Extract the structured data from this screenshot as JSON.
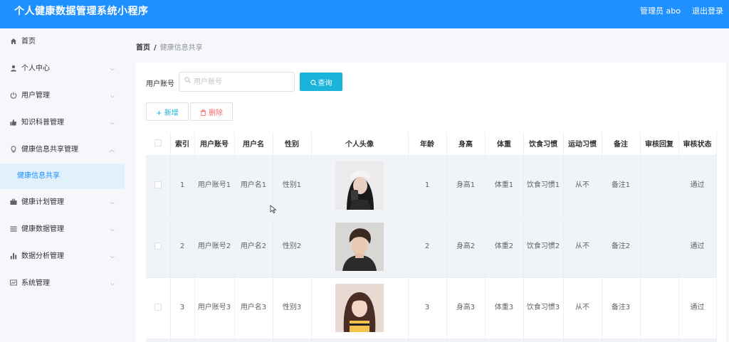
{
  "header": {
    "title": "个人健康数据管理系统小程序",
    "user": "管理员 abo",
    "logout": "退出登录"
  },
  "sidebar": {
    "items": [
      {
        "label": "首页",
        "icon": "home-icon",
        "chevron": false
      },
      {
        "label": "个人中心",
        "icon": "user-icon",
        "chevron": true
      },
      {
        "label": "用户管理",
        "icon": "power-icon",
        "chevron": true
      },
      {
        "label": "知识科普管理",
        "icon": "thumb-icon",
        "chevron": true
      },
      {
        "label": "健康信息共享管理",
        "icon": "bulb-icon",
        "chevron": true,
        "expanded": true
      },
      {
        "label": "健康信息共享",
        "sub": true
      },
      {
        "label": "健康计划管理",
        "icon": "briefcase-icon",
        "chevron": true
      },
      {
        "label": "健康数据管理",
        "icon": "list-icon",
        "chevron": true
      },
      {
        "label": "数据分析管理",
        "icon": "bar-chart-icon",
        "chevron": true
      },
      {
        "label": "系统管理",
        "icon": "monitor-icon",
        "chevron": true
      }
    ]
  },
  "breadcrumb": {
    "home": "首页",
    "sep": "/",
    "current": "健康信息共享"
  },
  "search": {
    "label": "用户账号",
    "placeholder": "用户账号",
    "button": "查询"
  },
  "actions": {
    "add": "+ 新增",
    "delete": "删除"
  },
  "table": {
    "columns": [
      "索引",
      "用户账号",
      "用户名",
      "性别",
      "个人头像",
      "年龄",
      "身高",
      "体重",
      "饮食习惯",
      "运动习惯",
      "备注",
      "审核回复",
      "审核状态"
    ],
    "rows": [
      {
        "index": "1",
        "account": "用户账号1",
        "name": "用户名1",
        "gender": "性别1",
        "age": "1",
        "height": "身高1",
        "weight": "体重1",
        "diet": "饮食习惯1",
        "exercise": "从不",
        "note": "备注1",
        "reply": "",
        "status": "通过"
      },
      {
        "index": "2",
        "account": "用户账号2",
        "name": "用户名2",
        "gender": "性别2",
        "age": "2",
        "height": "身高2",
        "weight": "体重2",
        "diet": "饮食习惯2",
        "exercise": "从不",
        "note": "备注2",
        "reply": "",
        "status": "通过"
      },
      {
        "index": "3",
        "account": "用户账号3",
        "name": "用户名3",
        "gender": "性别3",
        "age": "3",
        "height": "身高3",
        "weight": "体重3",
        "diet": "饮食习惯3",
        "exercise": "从不",
        "note": "备注3",
        "reply": "",
        "status": "通过"
      }
    ]
  },
  "colors": {
    "topbar": "#1e90ff",
    "primary": "#1ab3d9",
    "danger": "#f56c6c",
    "active_bg": "#e1f1fb"
  }
}
